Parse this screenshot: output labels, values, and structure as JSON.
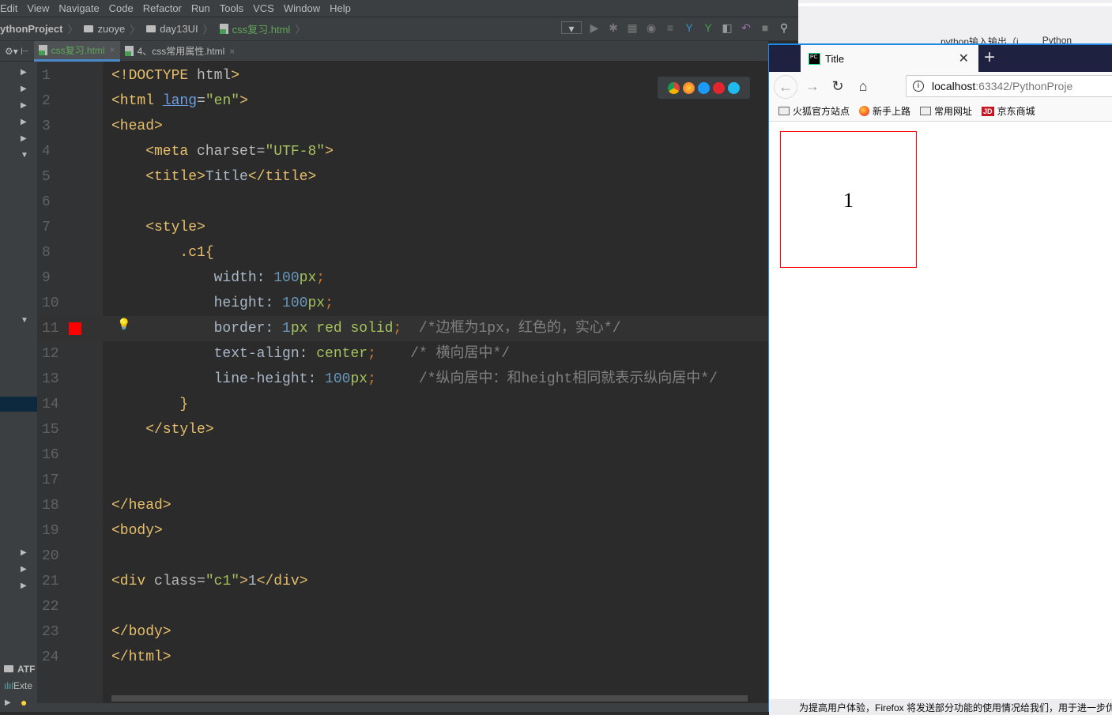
{
  "ide": {
    "menu": [
      "Edit",
      "View",
      "Navigate",
      "Code",
      "Refactor",
      "Run",
      "Tools",
      "VCS",
      "Window",
      "Help"
    ],
    "breadcrumb": [
      "ythonProject",
      "zuoye",
      "day13UI",
      "css复习.html"
    ],
    "tabs": [
      {
        "label": "css复习.html",
        "active": true
      },
      {
        "label": "4、css常用属性.html",
        "active": false
      }
    ],
    "project_items": [
      "ATF",
      "Exte"
    ],
    "line_numbers": [
      "1",
      "2",
      "3",
      "4",
      "5",
      "6",
      "7",
      "8",
      "9",
      "10",
      "11",
      "12",
      "13",
      "14",
      "15",
      "16",
      "17",
      "18",
      "19",
      "20",
      "21",
      "22",
      "23",
      "24"
    ]
  },
  "code": {
    "l1a": "<!DOCTYPE",
    "l1b": " html",
    "l1c": ">",
    "l2a": "<html ",
    "l2b": "lang",
    "l2c": "=",
    "l2d": "\"en\"",
    "l2e": ">",
    "l3": "<head>",
    "l4a": "    <meta ",
    "l4b": "charset",
    "l4c": "=",
    "l4d": "\"UTF-8\"",
    "l4e": ">",
    "l5a": "    <title>",
    "l5b": "Title",
    "l5c": "</title>",
    "l7": "    <style>",
    "l8a": "        .c1",
    "l8b": "{",
    "l9a": "            width: ",
    "l9b": "100",
    "l9c": "px",
    "l9d": ";",
    "l10a": "            height: ",
    "l10b": "100",
    "l10c": "px",
    "l10d": ";",
    "l11a": "            border: ",
    "l11b": "1",
    "l11c": "px red solid",
    "l11d": ";",
    "l11e": "  /*边框为1px，红色的，实心*/",
    "l12a": "            text-align: ",
    "l12b": "center",
    "l12c": ";",
    "l12d": "    /* 横向居中*/",
    "l13a": "            line-height: ",
    "l13b": "100",
    "l13c": "px",
    "l13d": ";",
    "l13e": "     /*纵向居中：和height相同就表示纵向居中*/",
    "l14": "        }",
    "l15": "    </style>",
    "l18": "</head>",
    "l19": "<body>",
    "l21a": "<div ",
    "l21b": "class",
    "l21c": "=",
    "l21d": "\"c1\"",
    "l21e": ">",
    "l21f": "1",
    "l21g": "</div>",
    "l23": "</body>",
    "l24": "</html>"
  },
  "background_window": {
    "bookmarks": [
      "python输入输出（j",
      "Python"
    ]
  },
  "browser": {
    "tab_title": "Title",
    "url_host": "localhost",
    "url_rest": ":63342/PythonProje",
    "bookmarks": [
      "火狐官方站点",
      "新手上路",
      "常用网址",
      "京东商城"
    ],
    "bookmark_jd_badge": "JD",
    "page_div_text": "1",
    "notice": "为提高用户体验，Firefox 将发送部分功能的使用情况给我们，用于进一步优化"
  }
}
